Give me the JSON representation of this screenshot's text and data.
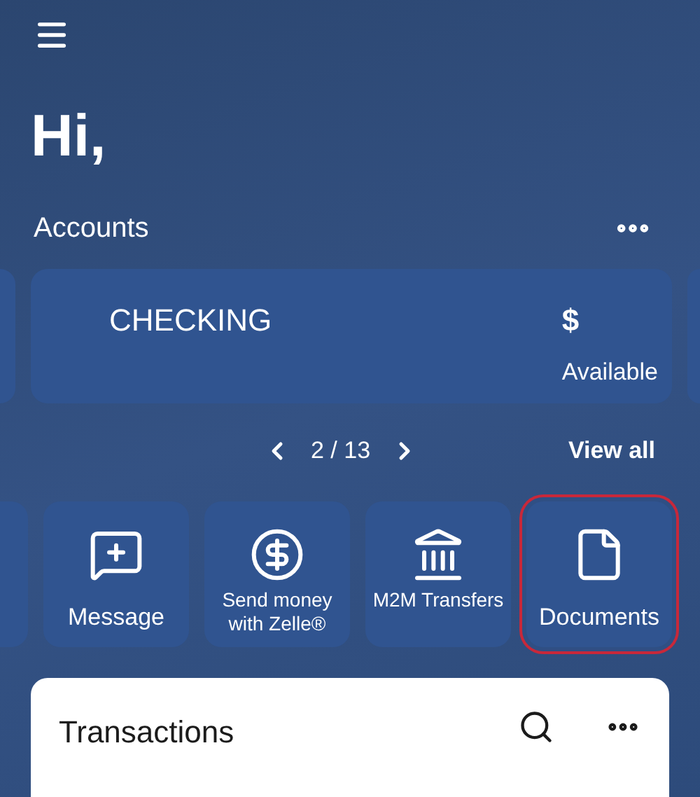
{
  "greeting": "Hi,",
  "accounts": {
    "title": "Accounts",
    "card": {
      "name": "CHECKING",
      "amount": "$",
      "amount_label": "Available"
    },
    "pager": {
      "position": "2 / 13"
    },
    "view_all": "View all"
  },
  "actions": [
    {
      "kind": "message",
      "label": "Message",
      "selected": false
    },
    {
      "kind": "zelle",
      "label": "Send money with Zelle®",
      "selected": false
    },
    {
      "kind": "bank",
      "label": "M2M Transfers",
      "selected": false
    },
    {
      "kind": "document",
      "label": "Documents",
      "selected": true
    }
  ],
  "transactions": {
    "title": "Transactions"
  }
}
